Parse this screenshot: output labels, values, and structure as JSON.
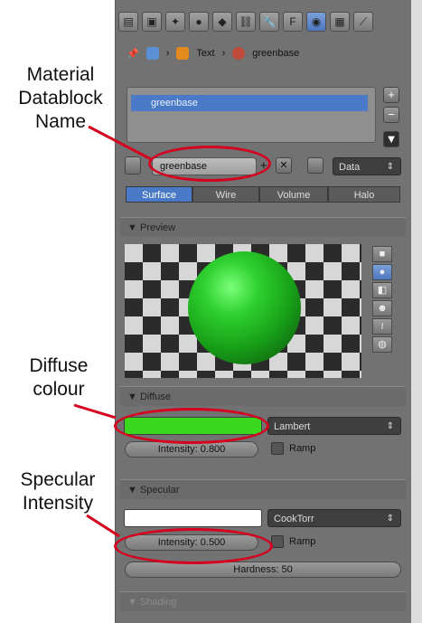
{
  "header": {
    "icons": [
      "panel-icon",
      "render-icon",
      "scene-icon",
      "world-icon",
      "object-icon",
      "constraint-icon",
      "modifier-icon",
      "data-icon",
      "material-icon",
      "texture-icon",
      "physics-icon"
    ],
    "data_glyph": "F"
  },
  "breadcrumb": {
    "object": "Text",
    "material": "greenbase"
  },
  "material_list": {
    "selected": "greenbase",
    "add_label": "+",
    "remove_label": "−",
    "down_label": "▼"
  },
  "datablock": {
    "name": "greenbase",
    "link_mode": "Data"
  },
  "tabs": [
    "Surface",
    "Wire",
    "Volume",
    "Halo"
  ],
  "preview": {
    "heading": "Preview"
  },
  "diffuse": {
    "heading": "Diffuse",
    "color": "#39d81f",
    "shader": "Lambert",
    "intensity_label": "Intensity: 0.800",
    "ramp_label": "Ramp"
  },
  "specular": {
    "heading": "Specular",
    "color": "#ffffff",
    "shader": "CookTorr",
    "intensity_label": "Intensity: 0.500",
    "ramp_label": "Ramp",
    "hardness_label": "Hardness: 50"
  },
  "shading": {
    "heading": "Shading"
  },
  "annotations": {
    "material_name": "Material\nDatablock\nName",
    "diffuse": "Diffuse\ncolour",
    "specular": "Specular\nIntensity"
  },
  "accent_color": "#d4001e"
}
